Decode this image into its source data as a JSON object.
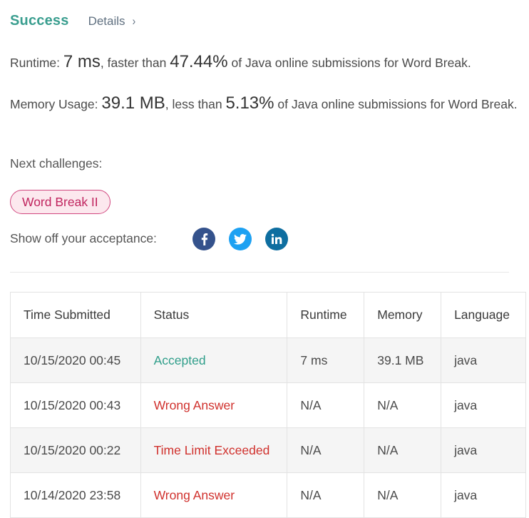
{
  "header": {
    "status": "Success",
    "details_label": "Details"
  },
  "runtime": {
    "label": "Runtime:",
    "value": "7 ms",
    "mid_text": ", faster than",
    "percent": "47.44%",
    "suffix": "of Java online submissions for Word Break."
  },
  "memory": {
    "label": "Memory Usage:",
    "value": "39.1 MB",
    "mid_text": ", less than",
    "percent": "5.13%",
    "suffix": "of Java online submissions for Word Break."
  },
  "next": {
    "label": "Next challenges:",
    "challenge": "Word Break II"
  },
  "share": {
    "label": "Show off your acceptance:",
    "icons": [
      "facebook-icon",
      "twitter-icon",
      "linkedin-icon"
    ]
  },
  "colors": {
    "success": "#3a9e8f",
    "accepted": "#2f9e8a",
    "error": "#d0312d",
    "chip_border": "#d1477f",
    "chip_text": "#c0245e"
  },
  "table": {
    "headers": [
      "Time Submitted",
      "Status",
      "Runtime",
      "Memory",
      "Language"
    ],
    "rows": [
      {
        "time": "10/15/2020 00:45",
        "status": "Accepted",
        "runtime": "7 ms",
        "memory": "39.1 MB",
        "language": "java"
      },
      {
        "time": "10/15/2020 00:43",
        "status": "Wrong Answer",
        "runtime": "N/A",
        "memory": "N/A",
        "language": "java"
      },
      {
        "time": "10/15/2020 00:22",
        "status": "Time Limit Exceeded",
        "runtime": "N/A",
        "memory": "N/A",
        "language": "java"
      },
      {
        "time": "10/14/2020 23:58",
        "status": "Wrong Answer",
        "runtime": "N/A",
        "memory": "N/A",
        "language": "java"
      }
    ]
  }
}
